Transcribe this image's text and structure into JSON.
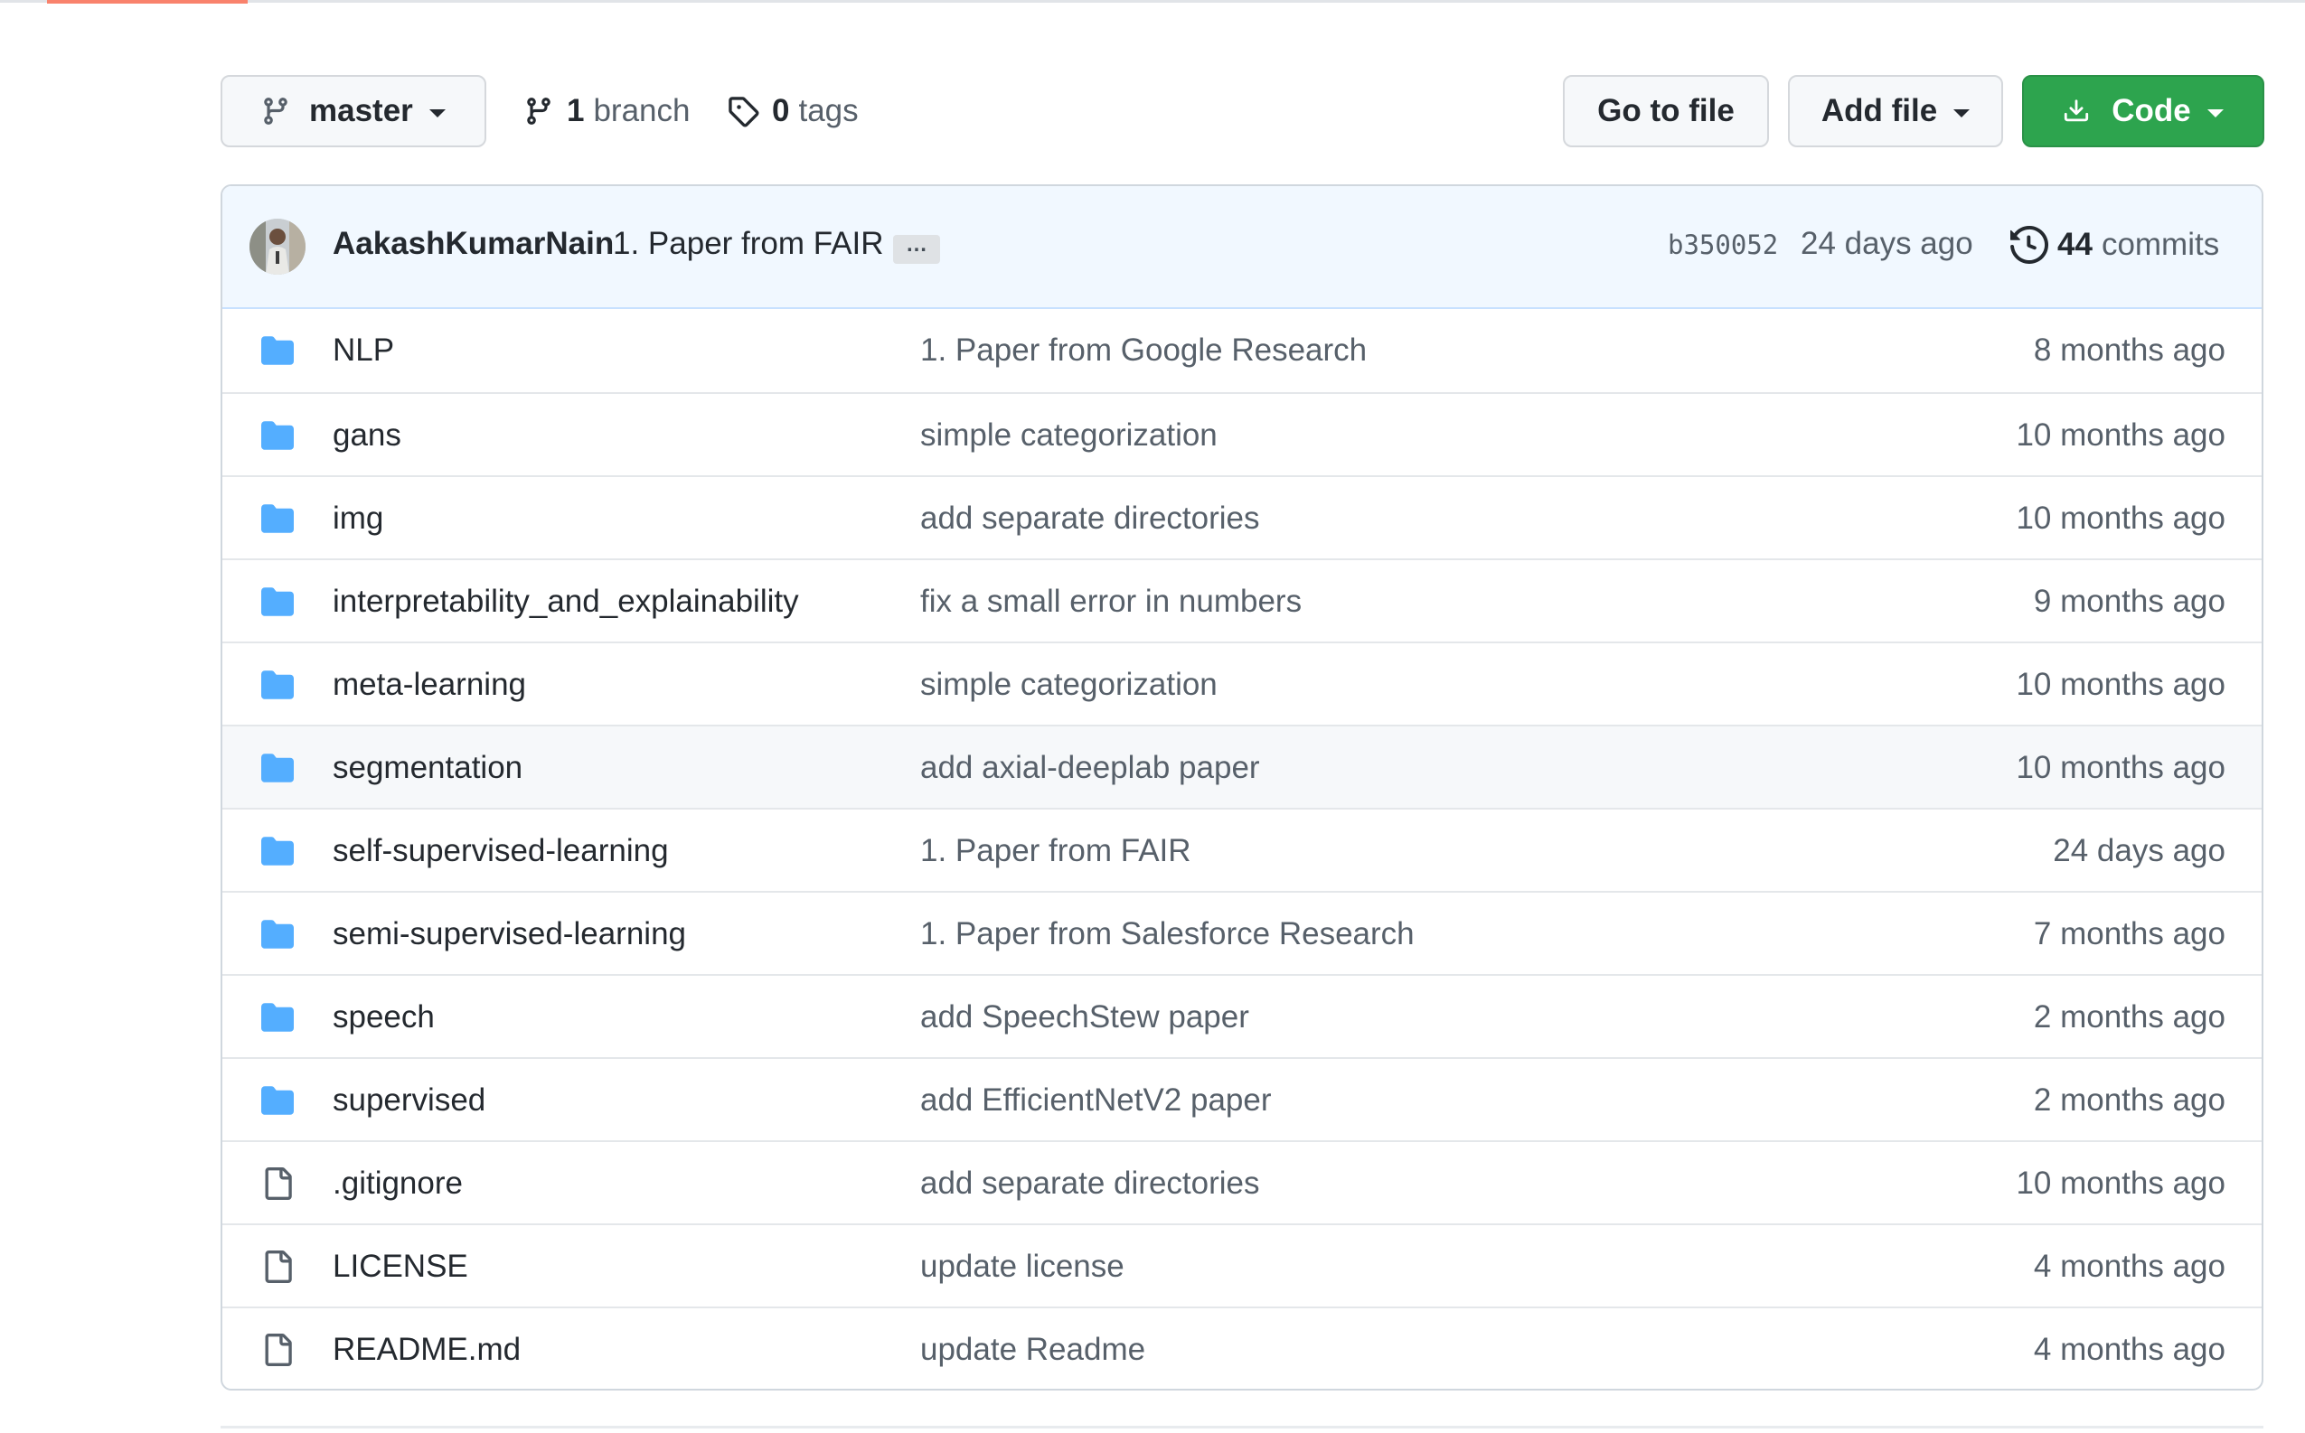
{
  "toolbar": {
    "branch_label": "master",
    "branch_count": "1",
    "branch_word": "branch",
    "tag_count": "0",
    "tag_word": "tags",
    "go_to_file_label": "Go to file",
    "add_file_label": "Add file",
    "code_label": "Code",
    "code_button_color": "#2da44e"
  },
  "commit": {
    "author": "AakashKumarNain",
    "message": "1. Paper from FAIR",
    "ellipsis": "…",
    "sha": "b350052",
    "time": "24 days ago",
    "commit_count": "44",
    "commit_word": "commits"
  },
  "files": [
    {
      "name": "NLP",
      "type": "folder",
      "message": "1. Paper from Google Research",
      "age": "8 months ago"
    },
    {
      "name": "gans",
      "type": "folder",
      "message": "simple categorization",
      "age": "10 months ago"
    },
    {
      "name": "img",
      "type": "folder",
      "message": "add separate directories",
      "age": "10 months ago"
    },
    {
      "name": "interpretability_and_explainability",
      "type": "folder",
      "message": "fix a small error in numbers",
      "age": "9 months ago"
    },
    {
      "name": "meta-learning",
      "type": "folder",
      "message": "simple categorization",
      "age": "10 months ago"
    },
    {
      "name": "segmentation",
      "type": "folder",
      "message": "add axial-deeplab paper",
      "age": "10 months ago"
    },
    {
      "name": "self-supervised-learning",
      "type": "folder",
      "message": "1. Paper from FAIR",
      "age": "24 days ago"
    },
    {
      "name": "semi-supervised-learning",
      "type": "folder",
      "message": "1. Paper from Salesforce Research",
      "age": "7 months ago"
    },
    {
      "name": "speech",
      "type": "folder",
      "message": "add SpeechStew paper",
      "age": "2 months ago"
    },
    {
      "name": "supervised",
      "type": "folder",
      "message": "add EfficientNetV2 paper",
      "age": "2 months ago"
    },
    {
      "name": ".gitignore",
      "type": "file",
      "message": "add separate directories",
      "age": "10 months ago"
    },
    {
      "name": "LICENSE",
      "type": "file",
      "message": "update license",
      "age": "4 months ago"
    },
    {
      "name": "README.md",
      "type": "file",
      "message": "update Readme",
      "age": "4 months ago"
    }
  ],
  "colors": {
    "folder_icon": "#54aeff",
    "file_icon": "#57606a",
    "accent_tab": "#f9826c",
    "commit_bar_bg": "#f1f8ff"
  }
}
